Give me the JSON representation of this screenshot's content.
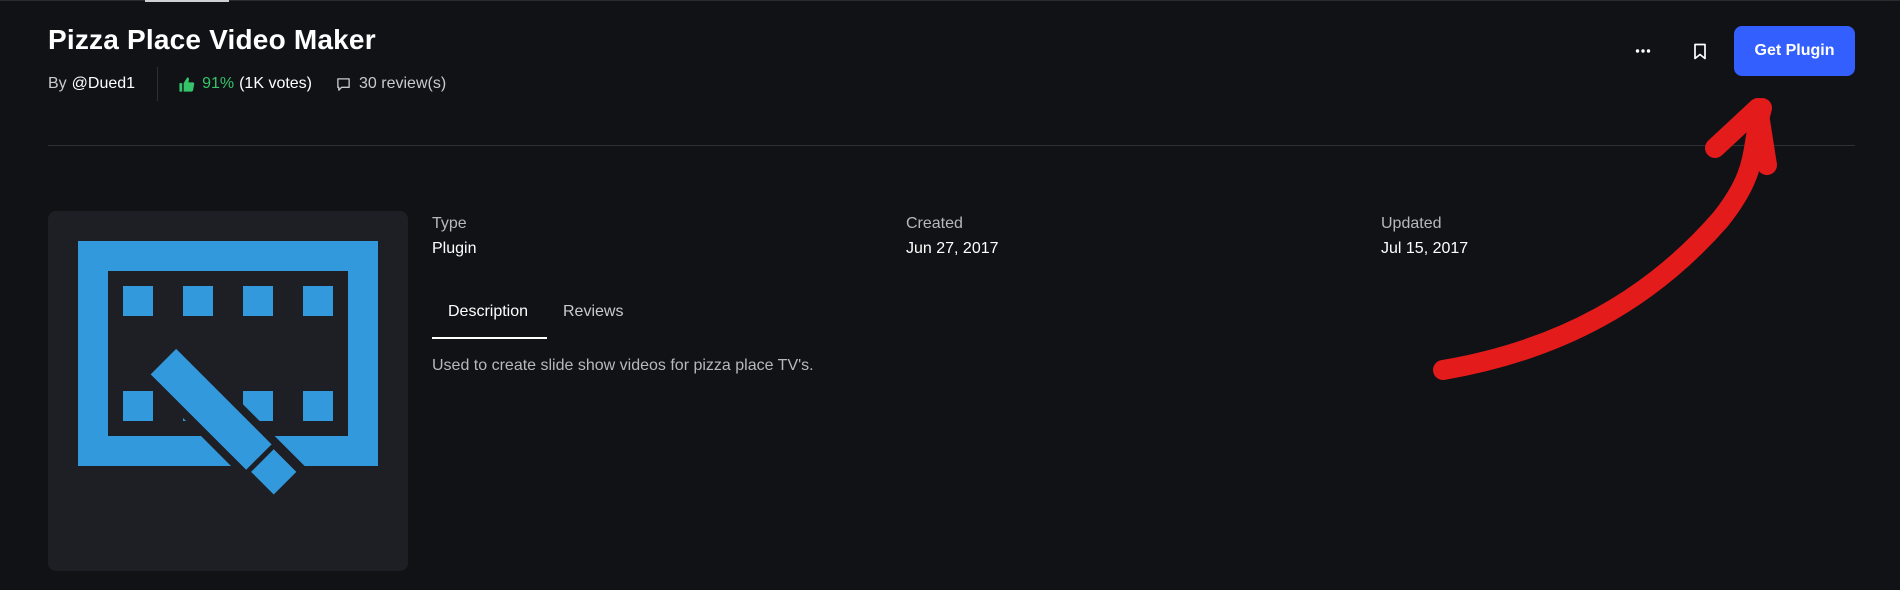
{
  "plugin": {
    "title": "Pizza Place Video Maker",
    "by_label": "By",
    "author": "@Dued1",
    "rating_percent": "91%",
    "votes": "(1K votes)",
    "reviews": "30 review(s)"
  },
  "actions": {
    "more_icon": "more-horizontal-icon",
    "bookmark_icon": "bookmark-icon",
    "get_label": "Get Plugin",
    "primary_color": "#335fff"
  },
  "meta": {
    "type_label": "Type",
    "type_value": "Plugin",
    "created_label": "Created",
    "created_value": "Jun 27, 2017",
    "updated_label": "Updated",
    "updated_value": "Jul 15, 2017"
  },
  "tabs": [
    {
      "label": "Description",
      "active": true
    },
    {
      "label": "Reviews",
      "active": false
    }
  ],
  "description": "Used to create slide show videos for pizza place TV's.",
  "thumbnail": {
    "icon": "film-pencil-icon",
    "color": "#3399dd"
  },
  "annotation": {
    "icon": "red-arrow-icon",
    "color": "#e31b1b"
  }
}
